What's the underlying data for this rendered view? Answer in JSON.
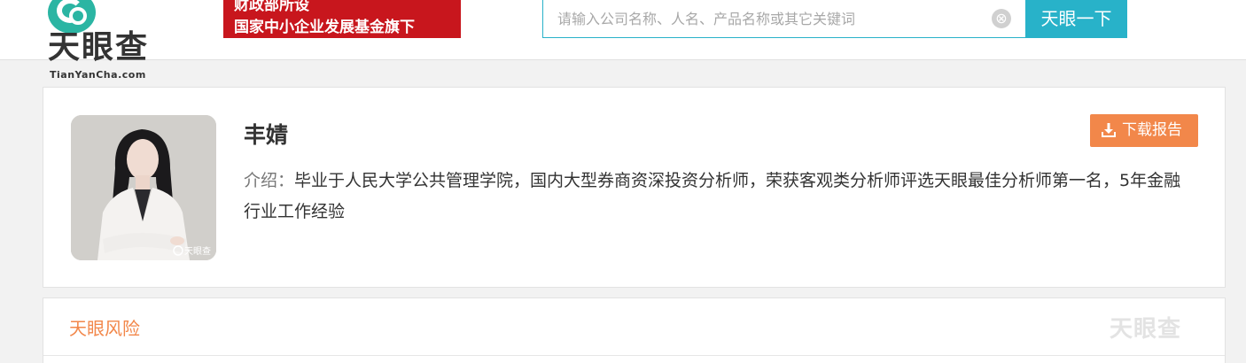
{
  "header": {
    "logo_text": "天眼查",
    "logo_sub": "TianYanCha.com",
    "banner_line1": "财政部所设",
    "banner_line2": "国家中小企业发展基金旗下",
    "search_placeholder": "请输入公司名称、人名、产品名称或其它关键词",
    "search_value": "",
    "search_button": "天眼一下",
    "clear_icon": "⊗"
  },
  "profile": {
    "name": "丰婧",
    "intro_label": "介绍：",
    "intro_text": "毕业于人民大学公共管理学院，国内大型券商资深投资分析师，荣获客观类分析师评选天眼最佳分析师第一名，5年金融行业工作经验",
    "download_button": "下载报告",
    "avatar_watermark": "天眼查"
  },
  "risk": {
    "title": "天眼风险",
    "watermark": "天眼查"
  },
  "colors": {
    "accent_blue": "#28b2c9",
    "accent_orange": "#f2874a",
    "banner_red": "#c8161d",
    "logo_teal": "#2bb5a3"
  }
}
